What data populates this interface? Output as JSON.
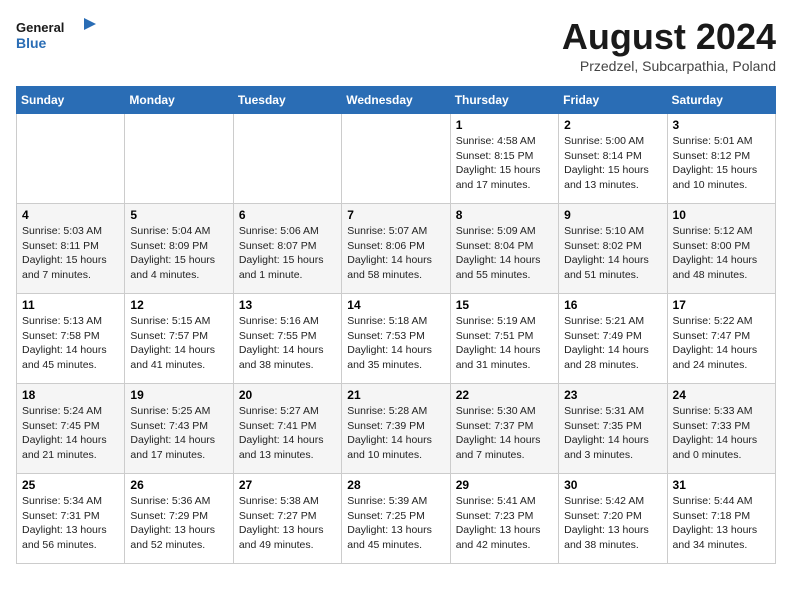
{
  "logo": {
    "line1": "General",
    "line2": "Blue"
  },
  "title": "August 2024",
  "subtitle": "Przedzel, Subcarpathia, Poland",
  "weekdays": [
    "Sunday",
    "Monday",
    "Tuesday",
    "Wednesday",
    "Thursday",
    "Friday",
    "Saturday"
  ],
  "weeks": [
    [
      {
        "day": "",
        "info": ""
      },
      {
        "day": "",
        "info": ""
      },
      {
        "day": "",
        "info": ""
      },
      {
        "day": "",
        "info": ""
      },
      {
        "day": "1",
        "info": "Sunrise: 4:58 AM\nSunset: 8:15 PM\nDaylight: 15 hours\nand 17 minutes."
      },
      {
        "day": "2",
        "info": "Sunrise: 5:00 AM\nSunset: 8:14 PM\nDaylight: 15 hours\nand 13 minutes."
      },
      {
        "day": "3",
        "info": "Sunrise: 5:01 AM\nSunset: 8:12 PM\nDaylight: 15 hours\nand 10 minutes."
      }
    ],
    [
      {
        "day": "4",
        "info": "Sunrise: 5:03 AM\nSunset: 8:11 PM\nDaylight: 15 hours\nand 7 minutes."
      },
      {
        "day": "5",
        "info": "Sunrise: 5:04 AM\nSunset: 8:09 PM\nDaylight: 15 hours\nand 4 minutes."
      },
      {
        "day": "6",
        "info": "Sunrise: 5:06 AM\nSunset: 8:07 PM\nDaylight: 15 hours\nand 1 minute."
      },
      {
        "day": "7",
        "info": "Sunrise: 5:07 AM\nSunset: 8:06 PM\nDaylight: 14 hours\nand 58 minutes."
      },
      {
        "day": "8",
        "info": "Sunrise: 5:09 AM\nSunset: 8:04 PM\nDaylight: 14 hours\nand 55 minutes."
      },
      {
        "day": "9",
        "info": "Sunrise: 5:10 AM\nSunset: 8:02 PM\nDaylight: 14 hours\nand 51 minutes."
      },
      {
        "day": "10",
        "info": "Sunrise: 5:12 AM\nSunset: 8:00 PM\nDaylight: 14 hours\nand 48 minutes."
      }
    ],
    [
      {
        "day": "11",
        "info": "Sunrise: 5:13 AM\nSunset: 7:58 PM\nDaylight: 14 hours\nand 45 minutes."
      },
      {
        "day": "12",
        "info": "Sunrise: 5:15 AM\nSunset: 7:57 PM\nDaylight: 14 hours\nand 41 minutes."
      },
      {
        "day": "13",
        "info": "Sunrise: 5:16 AM\nSunset: 7:55 PM\nDaylight: 14 hours\nand 38 minutes."
      },
      {
        "day": "14",
        "info": "Sunrise: 5:18 AM\nSunset: 7:53 PM\nDaylight: 14 hours\nand 35 minutes."
      },
      {
        "day": "15",
        "info": "Sunrise: 5:19 AM\nSunset: 7:51 PM\nDaylight: 14 hours\nand 31 minutes."
      },
      {
        "day": "16",
        "info": "Sunrise: 5:21 AM\nSunset: 7:49 PM\nDaylight: 14 hours\nand 28 minutes."
      },
      {
        "day": "17",
        "info": "Sunrise: 5:22 AM\nSunset: 7:47 PM\nDaylight: 14 hours\nand 24 minutes."
      }
    ],
    [
      {
        "day": "18",
        "info": "Sunrise: 5:24 AM\nSunset: 7:45 PM\nDaylight: 14 hours\nand 21 minutes."
      },
      {
        "day": "19",
        "info": "Sunrise: 5:25 AM\nSunset: 7:43 PM\nDaylight: 14 hours\nand 17 minutes."
      },
      {
        "day": "20",
        "info": "Sunrise: 5:27 AM\nSunset: 7:41 PM\nDaylight: 14 hours\nand 13 minutes."
      },
      {
        "day": "21",
        "info": "Sunrise: 5:28 AM\nSunset: 7:39 PM\nDaylight: 14 hours\nand 10 minutes."
      },
      {
        "day": "22",
        "info": "Sunrise: 5:30 AM\nSunset: 7:37 PM\nDaylight: 14 hours\nand 7 minutes."
      },
      {
        "day": "23",
        "info": "Sunrise: 5:31 AM\nSunset: 7:35 PM\nDaylight: 14 hours\nand 3 minutes."
      },
      {
        "day": "24",
        "info": "Sunrise: 5:33 AM\nSunset: 7:33 PM\nDaylight: 14 hours\nand 0 minutes."
      }
    ],
    [
      {
        "day": "25",
        "info": "Sunrise: 5:34 AM\nSunset: 7:31 PM\nDaylight: 13 hours\nand 56 minutes."
      },
      {
        "day": "26",
        "info": "Sunrise: 5:36 AM\nSunset: 7:29 PM\nDaylight: 13 hours\nand 52 minutes."
      },
      {
        "day": "27",
        "info": "Sunrise: 5:38 AM\nSunset: 7:27 PM\nDaylight: 13 hours\nand 49 minutes."
      },
      {
        "day": "28",
        "info": "Sunrise: 5:39 AM\nSunset: 7:25 PM\nDaylight: 13 hours\nand 45 minutes."
      },
      {
        "day": "29",
        "info": "Sunrise: 5:41 AM\nSunset: 7:23 PM\nDaylight: 13 hours\nand 42 minutes."
      },
      {
        "day": "30",
        "info": "Sunrise: 5:42 AM\nSunset: 7:20 PM\nDaylight: 13 hours\nand 38 minutes."
      },
      {
        "day": "31",
        "info": "Sunrise: 5:44 AM\nSunset: 7:18 PM\nDaylight: 13 hours\nand 34 minutes."
      }
    ]
  ]
}
